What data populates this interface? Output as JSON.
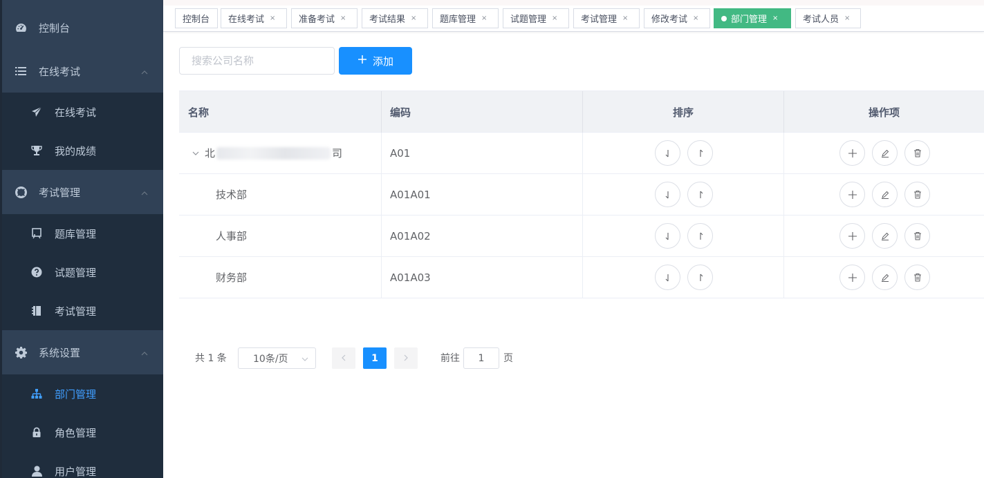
{
  "sidebar": {
    "dashboard": "控制台",
    "online_exam": "在线考试",
    "online_exam_sub": "在线考试",
    "my_scores": "我的成绩",
    "exam_mgmt": "考试管理",
    "question_bank": "题库管理",
    "question_mgmt": "试题管理",
    "exam_mgmt_sub": "考试管理",
    "system_settings": "系统设置",
    "dept_mgmt": "部门管理",
    "role_mgmt": "角色管理",
    "user_mgmt": "用户管理"
  },
  "tags": [
    {
      "label": "控制台"
    },
    {
      "label": "在线考试"
    },
    {
      "label": "准备考试"
    },
    {
      "label": "考试结果"
    },
    {
      "label": "题库管理"
    },
    {
      "label": "试题管理"
    },
    {
      "label": "考试管理"
    },
    {
      "label": "修改考试"
    },
    {
      "label": "部门管理"
    },
    {
      "label": "考试人员"
    }
  ],
  "tag_close": "×",
  "search": {
    "placeholder": "搜索公司名称",
    "value": ""
  },
  "add_button": "添加",
  "table": {
    "headers": [
      "名称",
      "编码",
      "排序",
      "操作项"
    ],
    "rows": [
      {
        "name_start": "北",
        "name_end": "司",
        "code": "A01"
      },
      {
        "name": "技术部",
        "code": "A01A01"
      },
      {
        "name": "人事部",
        "code": "A01A02"
      },
      {
        "name": "财务部",
        "code": "A01A03"
      }
    ]
  },
  "pagination": {
    "total": "共 1 条",
    "page_size": "10条/页",
    "current_page": "1",
    "goto_label": "前往",
    "goto_value": "1",
    "page_suffix": "页"
  },
  "colors": {
    "sidebar_bg": "#304156",
    "submenu_bg": "#1f2d3d",
    "active_tag": "#42b983",
    "primary": "#1890ff"
  }
}
